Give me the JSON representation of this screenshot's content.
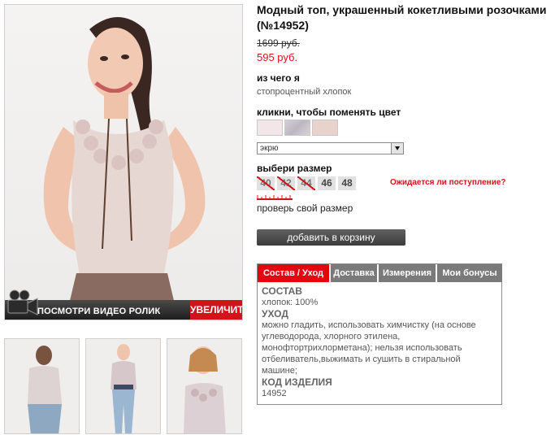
{
  "gallery": {
    "video_label": "ПОСМОТРИ ВИДЕО РОЛИК",
    "zoom_label": "УВЕЛИЧИТЬ"
  },
  "product": {
    "title": "Модный топ, украшенный кокетливыми розочками (№14952)",
    "old_price": "1699 руб.",
    "new_price": "595 руб.",
    "material_heading": "из чего я",
    "material_value": "стопроцентный хлопок",
    "color_heading": "кликни, чтобы поменять цвет",
    "color_selected": "экрю",
    "size_heading": "выбери размер",
    "sizes": [
      {
        "label": "40",
        "available": false
      },
      {
        "label": "42",
        "available": false
      },
      {
        "label": "44",
        "available": false
      },
      {
        "label": "46",
        "available": true
      },
      {
        "label": "48",
        "available": true
      }
    ],
    "await_link": "Ожидается ли поступление?",
    "check_size": "проверь свой размер",
    "add_to_cart": "добавить в корзину"
  },
  "tabs": {
    "items": [
      {
        "label": "Состав / Уход",
        "active": true
      },
      {
        "label": "Доставка",
        "active": false
      },
      {
        "label": "Измерения",
        "active": false
      },
      {
        "label": "Мои бонусы",
        "active": false
      }
    ],
    "content": {
      "composition_heading": "СОСТАВ",
      "composition_value": "хлопок: 100%",
      "care_heading": "УХОД",
      "care_value": "можно гладить, использовать химчистку (на основе углеводорода, хлорного этилена, монофтортрихлорметана); нельзя использовать отбеливатель,выжимать и сушить в стиральной машине;",
      "code_heading": "КОД ИЗДЕЛИЯ",
      "code_value": "14952"
    }
  },
  "colors": {
    "accent": "#d2141a",
    "tab_active": "#e3050f",
    "tab_inactive": "#7a7a7a"
  }
}
